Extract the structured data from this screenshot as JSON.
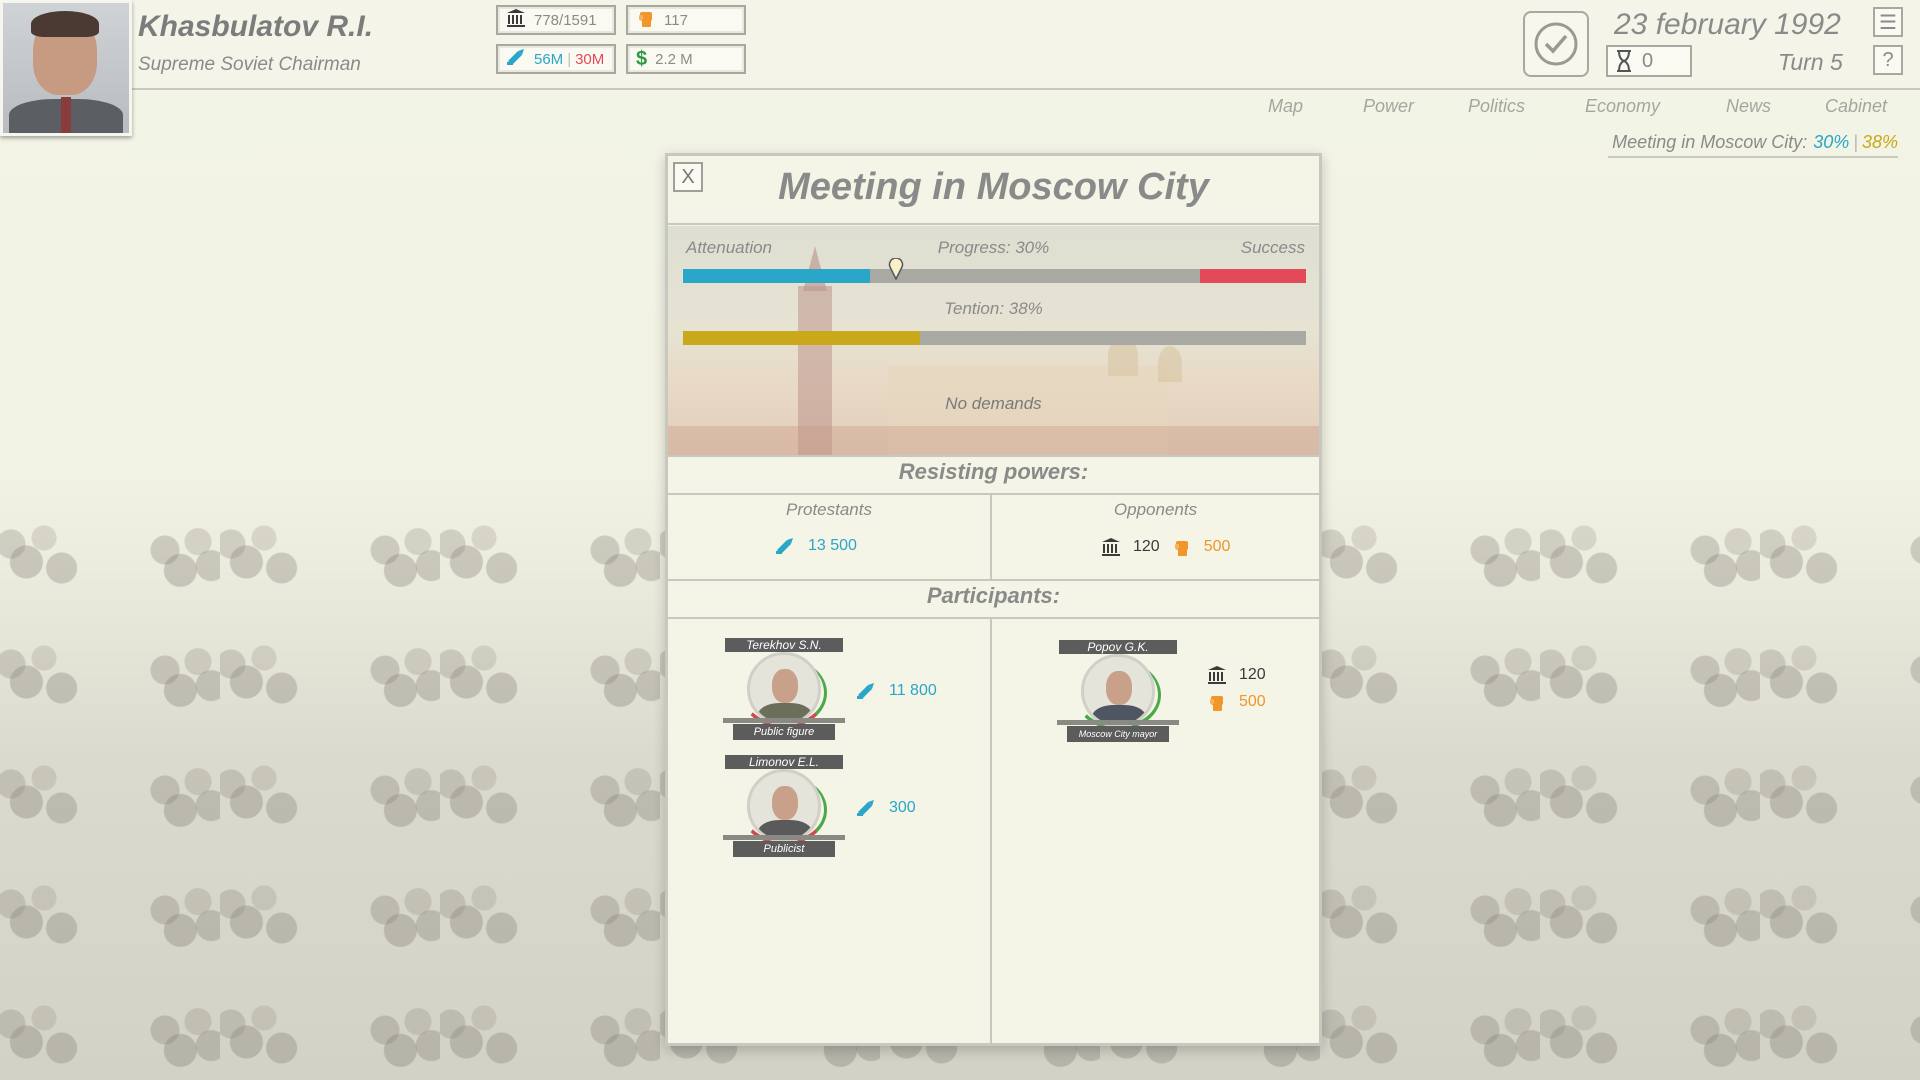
{
  "leader": {
    "name": "Khasbulatov R.I.",
    "title": "Supreme Soviet Chairman"
  },
  "stats": {
    "seats": "778/1591",
    "force": "117",
    "support_blue": "56M",
    "support_red": "30M",
    "money": "2.2 M"
  },
  "date": "23 february 1992",
  "turn": "Turn 5",
  "hourglass_value": "0",
  "help_label": "?",
  "nav": [
    "Map",
    "Power",
    "Politics",
    "Economy",
    "News",
    "Cabinet"
  ],
  "meeting_status": {
    "label": "Meeting in Moscow City:",
    "progress": "30%",
    "separator": "|",
    "tension": "38%"
  },
  "modal": {
    "close_label": "X",
    "title": "Meeting in Moscow City",
    "attenuation_label": "Attenuation",
    "progress_label": "Progress: 30%",
    "success_label": "Success",
    "tension_label": "Tention: 38%",
    "progress_fraction": 0.3,
    "tension_fraction": 0.38,
    "no_demands": "No demands",
    "resisting_title": "Resisting powers:",
    "protestants_title": "Protestants",
    "protestants_value": "13 500",
    "opponents_title": "Opponents",
    "opponents_seats": "120",
    "opponents_force": "500",
    "participants_title": "Participants:",
    "participants_left": [
      {
        "name": "Terekhov S.N.",
        "role": "Public figure",
        "value": "11 800"
      },
      {
        "name": "Limonov E.L.",
        "role": "Publicist",
        "value": "300"
      }
    ],
    "participants_right": [
      {
        "name": "Popov G.K.",
        "role": "Moscow City mayor",
        "seats": "120",
        "force": "500"
      }
    ]
  },
  "colors": {
    "blue": "#2aa6c8",
    "orange": "#f0962a",
    "red_success": "#e24a5a",
    "tension_yellow": "#c9a81a"
  },
  "icons": {
    "seats": "parliament-icon",
    "force": "fist-icon",
    "support": "megaphone-icon",
    "money": "dollar-icon"
  }
}
